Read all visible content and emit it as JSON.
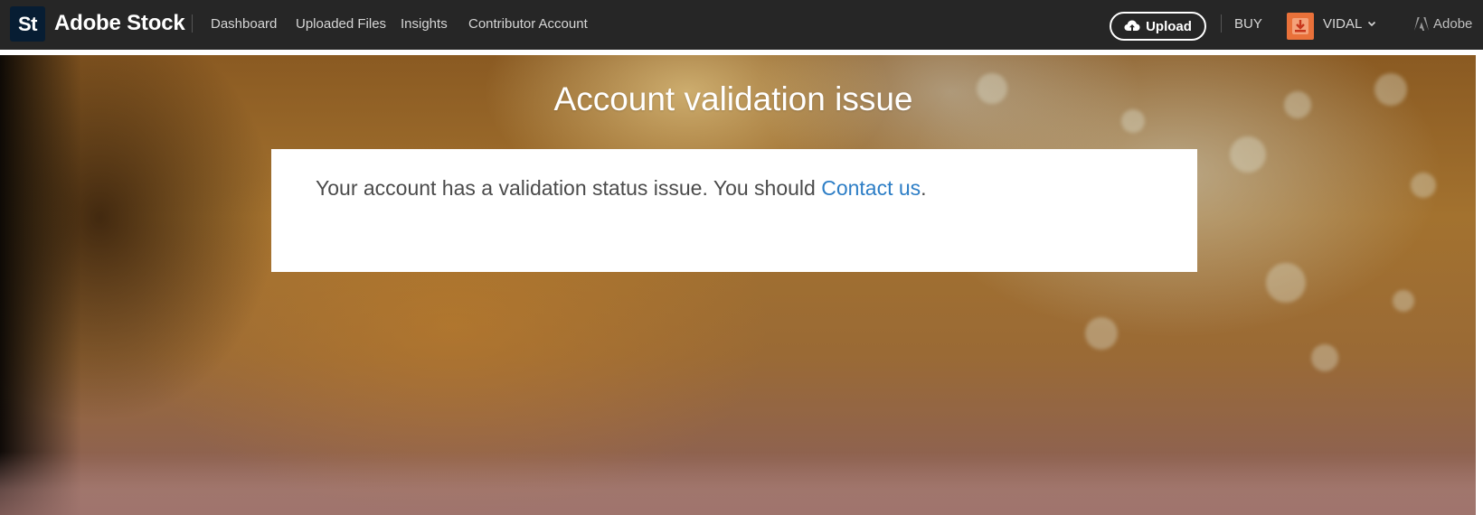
{
  "header": {
    "logo_text": "St",
    "brand": "Adobe Stock",
    "nav": [
      "Dashboard",
      "Uploaded Files",
      "Insights",
      "Contributor Account"
    ],
    "upload_label": "Upload",
    "buy_label": "BUY",
    "user_name": "VIDAL",
    "adobe_label": "Adobe"
  },
  "hero": {
    "title": "Account validation issue",
    "message_prefix": "Your account has a validation status issue. You should ",
    "contact_link": "Contact us",
    "message_suffix": "."
  },
  "colors": {
    "topbar": "#262626",
    "link": "#2d7ec6",
    "logo_tile": "#071d33",
    "avatar": "#e9713a"
  },
  "icons": {
    "upload": "cloud-upload-icon",
    "user_menu": "chevron-down-icon",
    "adobe": "adobe-logo-icon"
  }
}
